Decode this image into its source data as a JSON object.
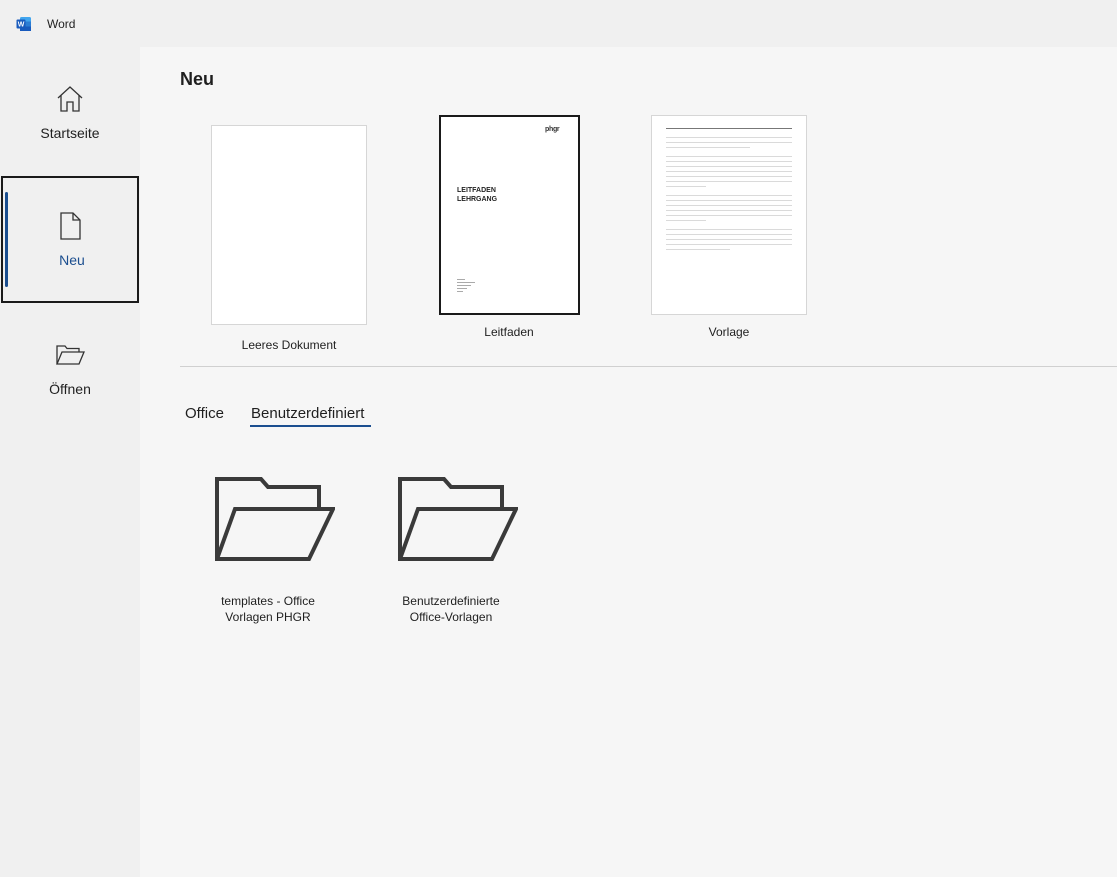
{
  "titlebar": {
    "app_name": "Word"
  },
  "sidebar": {
    "items": [
      {
        "label": "Startseite",
        "icon": "home-icon"
      },
      {
        "label": "Neu",
        "icon": "new-document-icon",
        "active": true
      },
      {
        "label": "Öffnen",
        "icon": "open-folder-icon"
      }
    ]
  },
  "main": {
    "title": "Neu",
    "templates": [
      {
        "label": "Leeres Dokument"
      },
      {
        "label": "Leitfaden",
        "logo": "phgr",
        "heading_line1": "LEITFADEN",
        "heading_line2": "LEHRGANG"
      },
      {
        "label": "Vorlage"
      }
    ],
    "tabs": [
      {
        "label": "Office"
      },
      {
        "label": "Benutzerdefiniert",
        "active": true
      }
    ],
    "folders": [
      {
        "line1": "templates - Office",
        "line2": "Vorlagen PHGR"
      },
      {
        "line1": "Benutzerdefinierte",
        "line2": "Office-Vorlagen"
      }
    ]
  },
  "colors": {
    "accent": "#1b4e8f",
    "word_brand": "#185abd"
  }
}
